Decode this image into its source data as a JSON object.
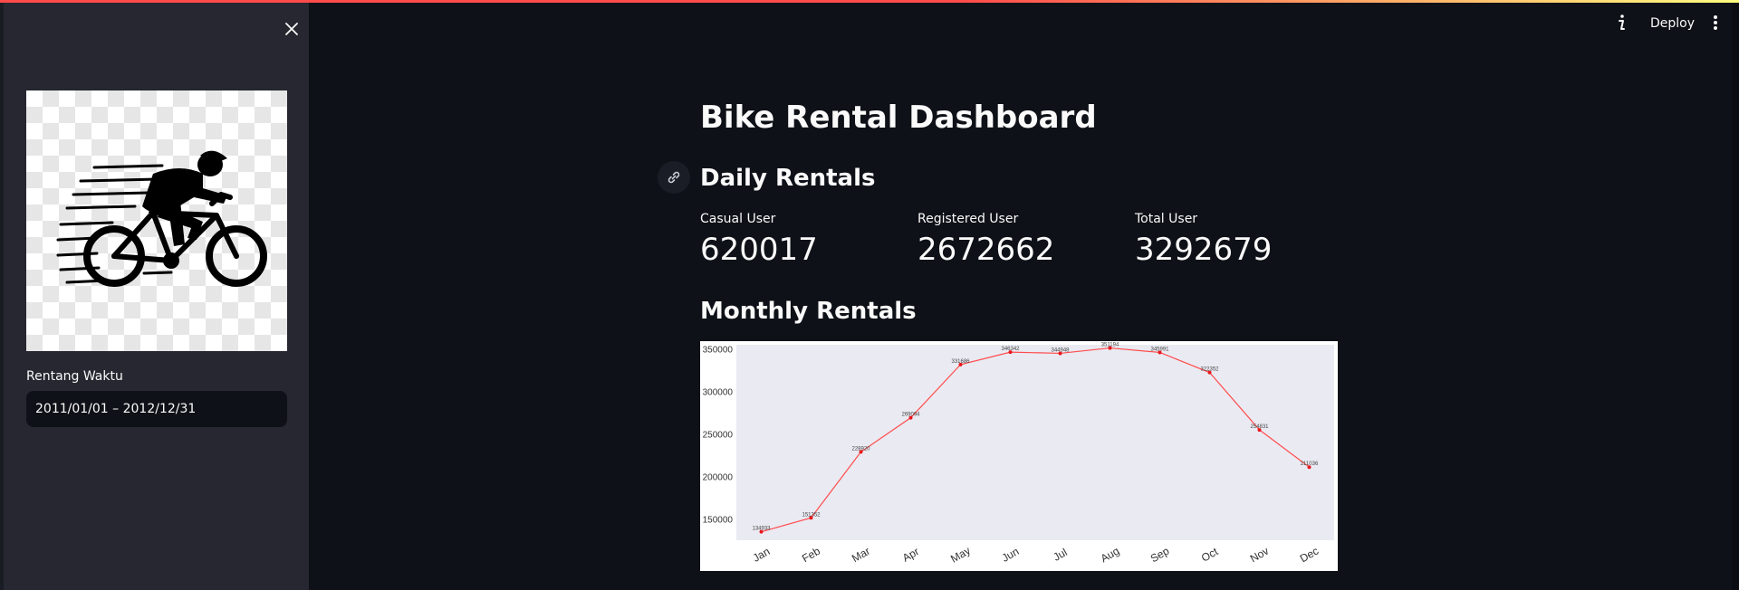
{
  "sidebar": {
    "close_icon": "close-icon",
    "logo": "cyclist-logo",
    "date_label": "Rentang Waktu",
    "date_value": "2011/01/01 – 2012/12/31"
  },
  "header": {
    "info_icon": "info-icon",
    "deploy_label": "Deploy",
    "menu_icon": "kebab-menu-icon"
  },
  "main": {
    "title": "Bike Rental Dashboard",
    "daily_heading": "Daily Rentals",
    "monthly_heading": "Monthly Rentals",
    "metrics": [
      {
        "label": "Casual User",
        "value": "620017"
      },
      {
        "label": "Registered User",
        "value": "2672662"
      },
      {
        "label": "Total User",
        "value": "3292679"
      }
    ]
  },
  "colors": {
    "background": "#0e1117",
    "sidebar": "#262730",
    "accent": "#ff4b4b",
    "line": "#ff4b4b",
    "plot_bg": "#eaeaf2"
  },
  "chart_data": {
    "type": "line",
    "categories": [
      "Jan",
      "Feb",
      "Mar",
      "Apr",
      "May",
      "Jun",
      "Jul",
      "Aug",
      "Sep",
      "Oct",
      "Nov",
      "Dec"
    ],
    "values": [
      134933,
      151352,
      228920,
      269094,
      331686,
      346342,
      344948,
      351194,
      345991,
      322352,
      254831,
      211036
    ],
    "ylim": [
      125000,
      355000
    ],
    "yticks": [
      150000,
      200000,
      250000,
      300000,
      350000
    ],
    "title": "",
    "xlabel": "",
    "ylabel": "",
    "grid": false
  }
}
